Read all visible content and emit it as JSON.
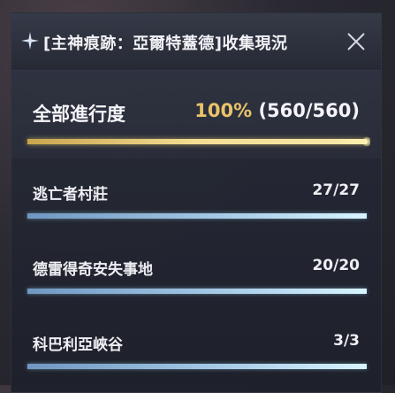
{
  "header": {
    "title": "[主神痕跡：亞爾特蓋德]收集現況",
    "icon": "sparkle-icon",
    "close_icon": "close-icon"
  },
  "overall": {
    "label": "全部進行度",
    "percent_text": "100%",
    "count_text": "(560/560)",
    "progress": 1.0,
    "color": "#e9c26a"
  },
  "regions": [
    {
      "name": "逃亡者村莊",
      "count": "27/27",
      "progress": 1.0
    },
    {
      "name": "德雷得奇安失事地",
      "count": "20/20",
      "progress": 1.0
    },
    {
      "name": "科巴利亞峽谷",
      "count": "3/3",
      "progress": 1.0
    }
  ]
}
